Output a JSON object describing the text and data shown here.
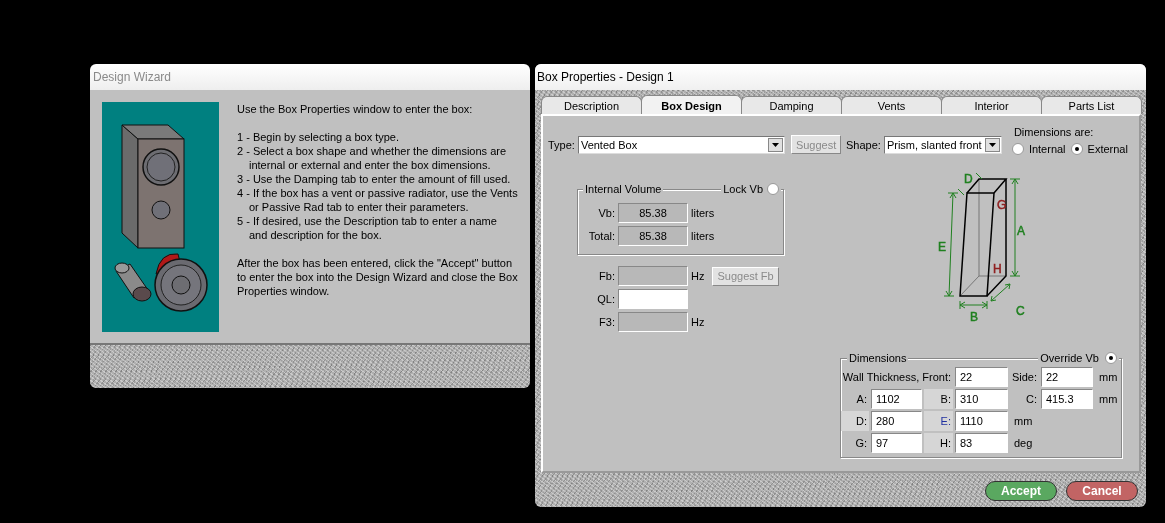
{
  "design_wizard": {
    "title": "Design Wizard",
    "intro": "Use the Box Properties window to enter the box:",
    "steps": [
      "1 - Begin by selecting a box type.",
      "2 - Select a box shape and whether the dimensions are internal or external and enter the box dimensions.",
      "3 - Use the Damping tab to enter the amount of fill used.",
      "4 - If the box has a vent or passive radiator, use the Vents or Passive Rad tab to enter their parameters.",
      "5 - If desired, use the Description tab to enter a name and description for the box."
    ],
    "closing": "After the box has been entered, click the \"Accept\" button to enter the box into the Design Wizard and close the Box Properties window."
  },
  "box_properties": {
    "title": "Box Properties - Design 1",
    "tabs": [
      {
        "label": "Description",
        "selected": false
      },
      {
        "label": "Box Design",
        "selected": true
      },
      {
        "label": "Damping",
        "selected": false
      },
      {
        "label": "Vents",
        "selected": false
      },
      {
        "label": "Interior",
        "selected": false
      },
      {
        "label": "Parts List",
        "selected": false
      }
    ],
    "type": {
      "label": "Type:",
      "value": "Vented Box"
    },
    "suggest_button": {
      "label": "Suggest",
      "disabled": true
    },
    "shape": {
      "label": "Shape:",
      "value": "Prism, slanted front"
    },
    "dimensions_are": {
      "label": "Dimensions are:",
      "options": [
        {
          "label": "Internal",
          "selected": false
        },
        {
          "label": "External",
          "selected": true
        }
      ]
    },
    "internal_volume": {
      "title": "Internal Volume",
      "lock": {
        "label": "Lock Vb",
        "selected": false
      },
      "rows": [
        {
          "label": "Vb:",
          "value": "85.38",
          "unit": "liters"
        },
        {
          "label": "Total:",
          "value": "85.38",
          "unit": "liters"
        }
      ]
    },
    "tuning_fields": [
      {
        "label": "Fb:",
        "disabled": true,
        "unit": "Hz"
      },
      {
        "label": "QL:",
        "disabled": false
      },
      {
        "label": "F3:",
        "disabled": true,
        "unit": "Hz"
      }
    ],
    "suggest_fb_button": {
      "label": "Suggest Fb",
      "disabled": true
    },
    "diagram_labels": [
      {
        "text": "D",
        "color": "#208020"
      },
      {
        "text": "G",
        "color": "#902020"
      },
      {
        "text": "A",
        "color": "#208020"
      },
      {
        "text": "E",
        "color": "#208020"
      },
      {
        "text": "H",
        "color": "#902020"
      },
      {
        "text": "C",
        "color": "#208020"
      },
      {
        "text": "B",
        "color": "#208020"
      }
    ],
    "dimensions": {
      "title": "Dimensions",
      "override": {
        "label": "Override Vb",
        "selected": true
      },
      "wall_thickness": {
        "front_label": "Wall Thickness, Front:",
        "front": "22",
        "side_label": "Side:",
        "side": "22",
        "unit": "mm"
      },
      "rows": [
        [
          {
            "kind": "label",
            "text": "A:",
            "highlighted": false,
            "focused": false
          },
          {
            "kind": "field",
            "value": "1102"
          },
          {
            "kind": "label",
            "text": "B:",
            "highlighted": true,
            "focused": false
          },
          {
            "kind": "field",
            "value": "310"
          },
          {
            "kind": "label",
            "text": "C:",
            "highlighted": false,
            "focused": false
          },
          {
            "kind": "field",
            "value": "415.3"
          },
          {
            "kind": "unit",
            "text": "mm"
          }
        ],
        [
          {
            "kind": "label",
            "text": "D:",
            "highlighted": true,
            "focused": false
          },
          {
            "kind": "field",
            "value": "280"
          },
          {
            "kind": "label",
            "text": "E:",
            "highlighted": true,
            "focused": true
          },
          {
            "kind": "field",
            "value": "1110"
          },
          {
            "kind": "unit",
            "text": "mm"
          }
        ],
        [
          {
            "kind": "label",
            "text": "G:",
            "highlighted": false,
            "focused": false
          },
          {
            "kind": "field",
            "value": "97"
          },
          {
            "kind": "label",
            "text": "H:",
            "highlighted": true,
            "focused": false
          },
          {
            "kind": "field",
            "value": "83"
          },
          {
            "kind": "unit",
            "text": "deg"
          }
        ]
      ]
    },
    "buttons": [
      {
        "label": "Accept",
        "color": "#5aa860"
      },
      {
        "label": "Cancel",
        "color": "#c26464"
      }
    ]
  }
}
